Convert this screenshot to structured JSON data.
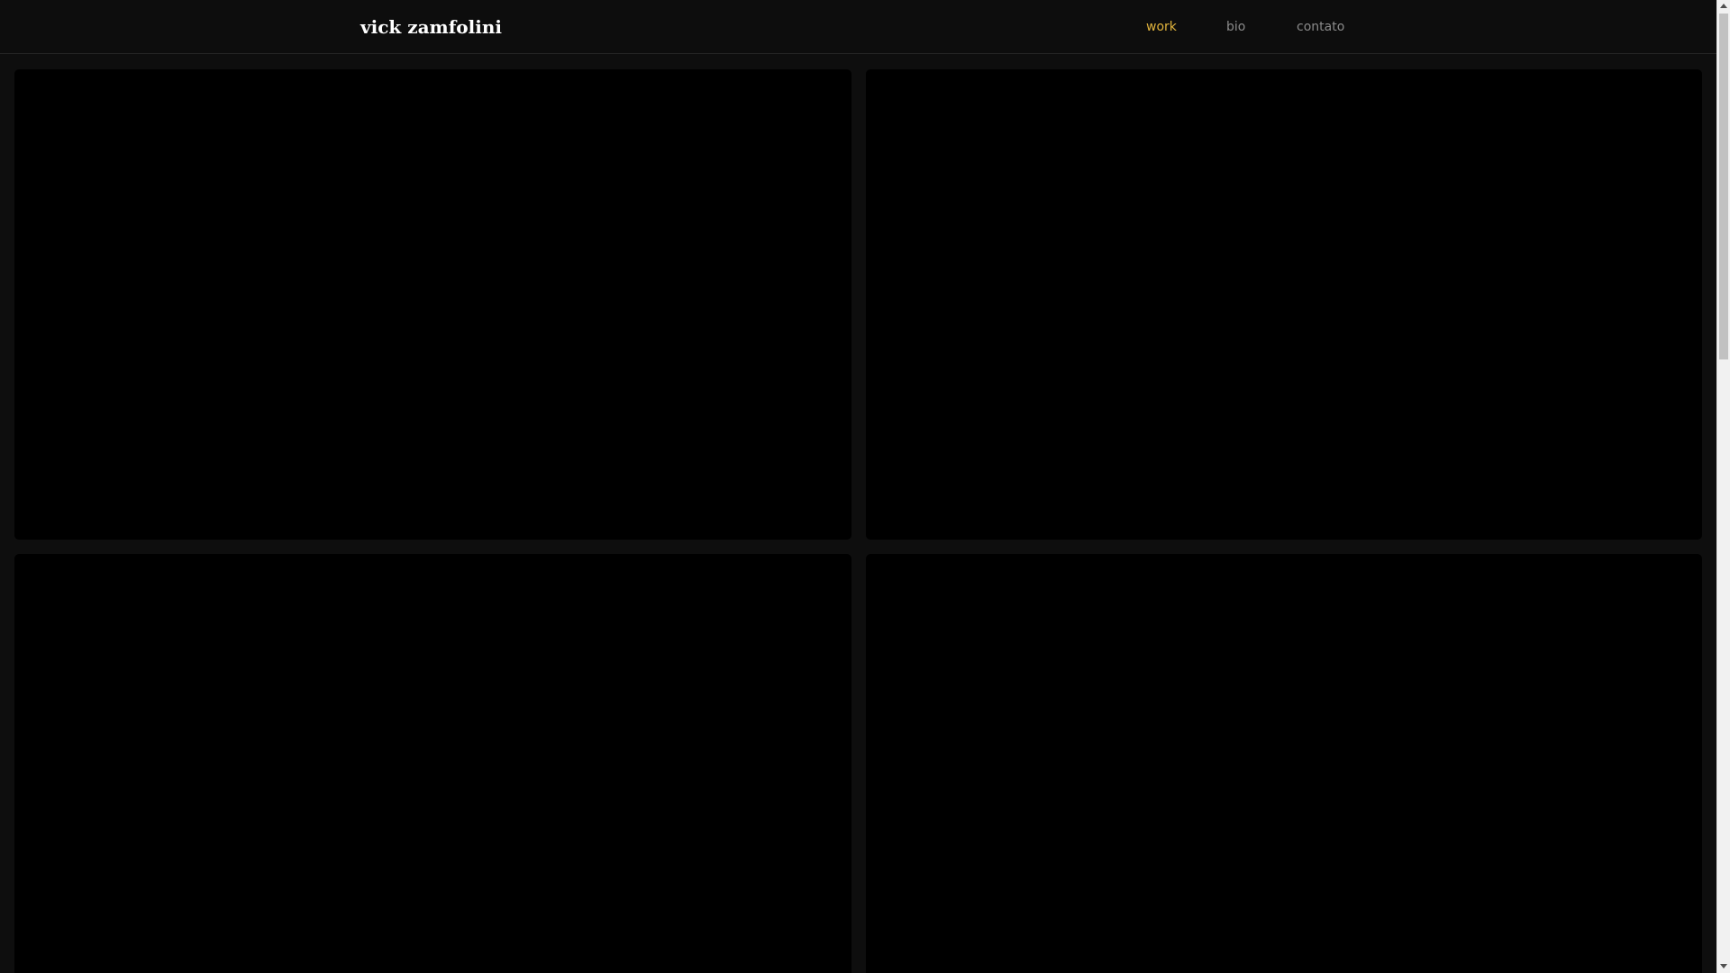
{
  "header": {
    "brand": "vick zamfolini",
    "nav": [
      {
        "label": "work",
        "active": true
      },
      {
        "label": "bio",
        "active": false
      },
      {
        "label": "contato",
        "active": false
      }
    ]
  },
  "colors": {
    "page_background": "#0e0e0e",
    "header_background": "#0d0d0d",
    "tile_background": "#000000",
    "nav_active": "#e0b33c",
    "nav_inactive": "#8a8a8a",
    "brand": "#ffffff"
  },
  "gallery": {
    "tiles": [
      {
        "id": "tile-1"
      },
      {
        "id": "tile-2"
      },
      {
        "id": "tile-3"
      },
      {
        "id": "tile-4"
      }
    ]
  },
  "scrollbar": {
    "scroll_fraction": 0.0
  }
}
